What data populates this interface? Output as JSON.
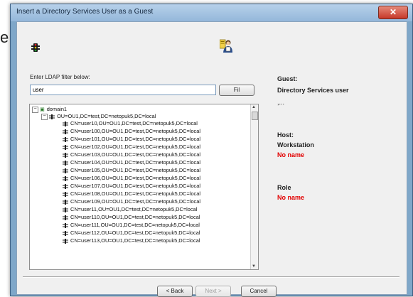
{
  "background_char": "e",
  "window": {
    "title": "Insert a Directory Services User as a Guest",
    "close_label": "✕"
  },
  "filter": {
    "label": "Enter LDAP filter below:",
    "value": "user",
    "button_label": "Fil"
  },
  "tree": {
    "root": "domain1",
    "ou": "OU=OU1,DC=test,DC=netopuk5,DC=local",
    "items": [
      "CN=user10,OU=OU1,DC=test,DC=netopuk5,DC=local",
      "CN=user100,OU=OU1,DC=test,DC=netopuk5,DC=local",
      "CN=user101,OU=OU1,DC=test,DC=netopuk5,DC=local",
      "CN=user102,OU=OU1,DC=test,DC=netopuk5,DC=local",
      "CN=user103,OU=OU1,DC=test,DC=netopuk5,DC=local",
      "CN=user104,OU=OU1,DC=test,DC=netopuk5,DC=local",
      "CN=user105,OU=OU1,DC=test,DC=netopuk5,DC=local",
      "CN=user106,OU=OU1,DC=test,DC=netopuk5,DC=local",
      "CN=user107,OU=OU1,DC=test,DC=netopuk5,DC=local",
      "CN=user108,OU=OU1,DC=test,DC=netopuk5,DC=local",
      "CN=user109,OU=OU1,DC=test,DC=netopuk5,DC=local",
      "CN=user11,OU=OU1,DC=test,DC=netopuk5,DC=local",
      "CN=user110,OU=OU1,DC=test,DC=netopuk5,DC=local",
      "CN=user111,OU=OU1,DC=test,DC=netopuk5,DC=local",
      "CN=user112,OU=OU1,DC=test,DC=netopuk5,DC=local",
      "CN=user113,OU=OU1,DC=test,DC=netopuk5,DC=local"
    ]
  },
  "info": {
    "guest_label": "Guest:",
    "guest_value": "Directory Services user",
    "guest_extra": ",...",
    "host_label": "Host:",
    "workstation_label": "Workstation",
    "workstation_value": "No name",
    "role_label": "Role",
    "role_value": "No name"
  },
  "buttons": {
    "back": "< Back",
    "next": "Next >",
    "cancel": "Cancel"
  },
  "colors": {
    "accent_red": "#e20000",
    "titlebar": "#9fbfe0",
    "tree_border": "#8f8f8f"
  }
}
